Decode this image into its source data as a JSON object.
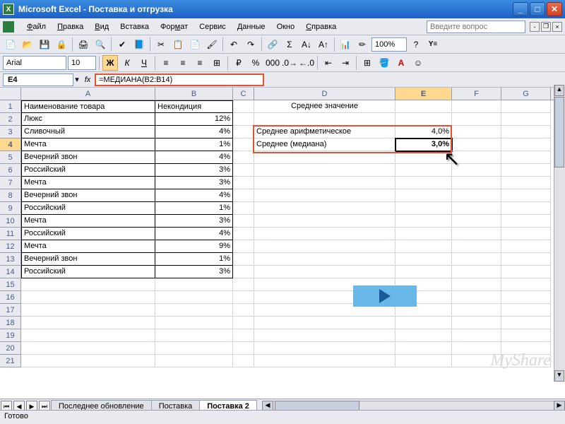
{
  "window": {
    "app": "Microsoft Excel",
    "doc": "Поставка и отгрузка"
  },
  "menu": {
    "file": "Файл",
    "edit": "Правка",
    "view": "Вид",
    "insert": "Вставка",
    "format": "Формат",
    "tools": "Сервис",
    "data": "Данные",
    "window": "Окно",
    "help": "Справка",
    "search_placeholder": "Введите вопрос"
  },
  "format_toolbar": {
    "font": "Arial",
    "size": "10",
    "bold": "Ж",
    "italic": "К",
    "underline": "Ч",
    "zoom": "100%"
  },
  "formula": {
    "cell_ref": "E4",
    "fx": "fx",
    "value": "=МЕДИАНА(B2:B14)"
  },
  "columns": [
    "A",
    "B",
    "C",
    "D",
    "E",
    "F",
    "G"
  ],
  "selected_col": "E",
  "selected_row": 4,
  "headers": {
    "A1": "Наименование товара",
    "B1": "Некондиция",
    "D1": "Среднее значение"
  },
  "data_rows": [
    {
      "name": "Люкс",
      "pct": "12%"
    },
    {
      "name": "Сливочный",
      "pct": "4%"
    },
    {
      "name": "Мечта",
      "pct": "1%"
    },
    {
      "name": "Вечерний звон",
      "pct": "4%"
    },
    {
      "name": "Российский",
      "pct": "3%"
    },
    {
      "name": "Мечта",
      "pct": "3%"
    },
    {
      "name": "Вечерний звон",
      "pct": "4%"
    },
    {
      "name": "Российский",
      "pct": "1%"
    },
    {
      "name": "Мечта",
      "pct": "3%"
    },
    {
      "name": "Российский",
      "pct": "4%"
    },
    {
      "name": "Мечта",
      "pct": "9%"
    },
    {
      "name": "Вечерний звон",
      "pct": "1%"
    },
    {
      "name": "Российский",
      "pct": "3%"
    }
  ],
  "stats": {
    "mean_label": "Среднее арифметическое",
    "mean_value": "4,0%",
    "median_label": "Среднее (медиана)",
    "median_value": "3,0%"
  },
  "tabs": {
    "t1": "Последнее обновление",
    "t2": "Поставка",
    "t3": "Поставка 2"
  },
  "status": "Готово",
  "watermark": "MyShare"
}
